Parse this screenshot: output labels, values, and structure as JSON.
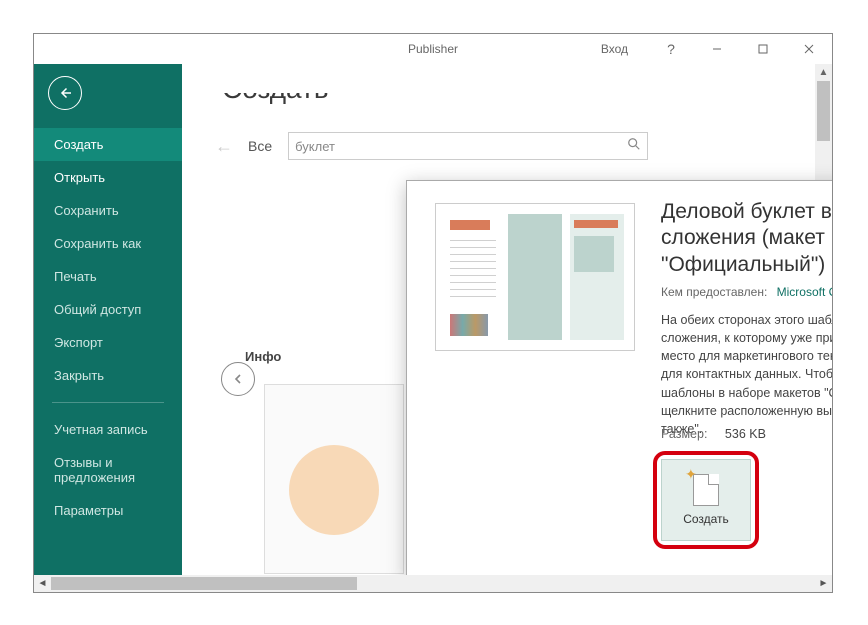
{
  "app": {
    "title": "Publisher"
  },
  "titlebar": {
    "signin": "Вход",
    "help": "?",
    "minimize": "—",
    "maximize": "□",
    "close": "✕"
  },
  "sidebar": {
    "items": [
      {
        "label": "Создать"
      },
      {
        "label": "Открыть"
      },
      {
        "label": "Сохранить"
      },
      {
        "label": "Сохранить как"
      },
      {
        "label": "Печать"
      },
      {
        "label": "Общий доступ"
      },
      {
        "label": "Экспорт"
      },
      {
        "label": "Закрыть"
      }
    ],
    "footer": [
      {
        "label": "Учетная запись"
      },
      {
        "label": "Отзывы и предложения"
      },
      {
        "label": "Параметры"
      }
    ]
  },
  "content": {
    "ghost_heading_fragment": "Создать",
    "breadcrumb_back": "←",
    "breadcrumb": "Все",
    "search_value": "буклет",
    "info_label": "Инфо"
  },
  "modal": {
    "title": "Деловой буклет в три сложения (макет \"Официальный\")",
    "provided_by_label": "Кем предоставлен:",
    "provided_by_value": "Microsoft Corporation",
    "description": "На обеих сторонах этого шаблона буклета в три сложения, к которому уже применена тема, есть место для маркетингового текста, а на задней — для контактных данных. Чтобы найти похожие шаблоны в наборе макетов \"Официальный\", щелкните расположенную выше ссылку \"См. также\".",
    "size_label": "Размер:",
    "size_value": "536 KB",
    "create_label": "Создать",
    "close": "✕",
    "pin": "📌"
  }
}
